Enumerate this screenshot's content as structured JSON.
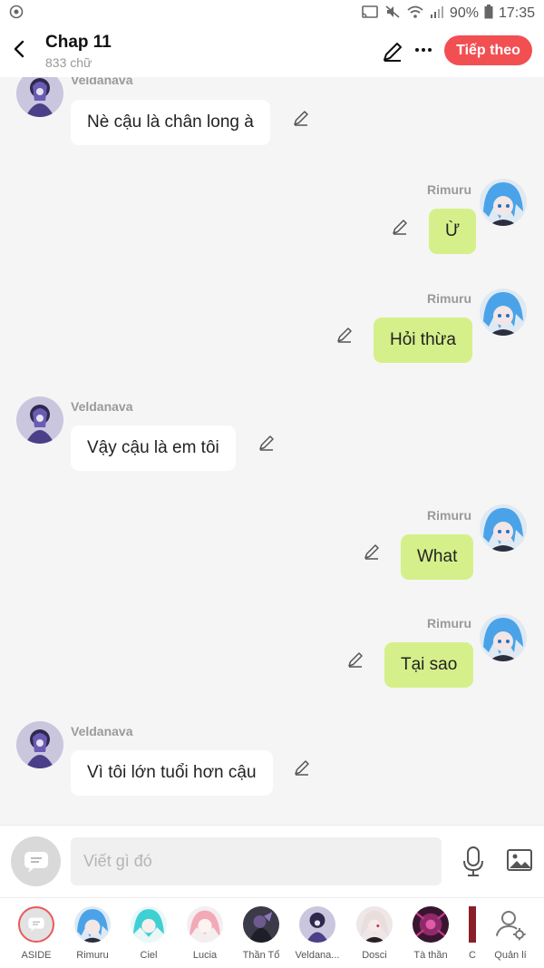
{
  "status_bar": {
    "battery": "90%",
    "time": "17:35"
  },
  "header": {
    "title": "Chap 11",
    "word_count": "833 chữ",
    "next_label": "Tiếp theo"
  },
  "messages": [
    {
      "sender": "Veldanava",
      "text": "Nè cậu là chân long à",
      "side": "left",
      "avatar": "veldanava-avatar"
    },
    {
      "sender": "Rimuru",
      "text": "Ừ",
      "side": "right",
      "avatar": "rimuru-avatar"
    },
    {
      "sender": "Rimuru",
      "text": "Hỏi thừa",
      "side": "right",
      "avatar": "rimuru-avatar"
    },
    {
      "sender": "Veldanava",
      "text": "Vậy cậu là em tôi",
      "side": "left",
      "avatar": "veldanava-avatar"
    },
    {
      "sender": "Rimuru",
      "text": "What",
      "side": "right",
      "avatar": "rimuru-avatar"
    },
    {
      "sender": "Rimuru",
      "text": "Tại sao",
      "side": "right",
      "avatar": "rimuru-avatar"
    },
    {
      "sender": "Veldanava",
      "text": "Vì tôi lớn tuổi hơn cậu",
      "side": "left",
      "avatar": "veldanava-avatar"
    }
  ],
  "composer": {
    "placeholder": "Viết gì đó",
    "value": ""
  },
  "characters": [
    {
      "name": "ASIDE"
    },
    {
      "name": "Rimuru"
    },
    {
      "name": "Ciel"
    },
    {
      "name": "Lucia"
    },
    {
      "name": "Thần Tổ"
    },
    {
      "name": "Veldana..."
    },
    {
      "name": "Dosci"
    },
    {
      "name": "Tà thần"
    },
    {
      "name": "C"
    },
    {
      "name": "Quản lí"
    }
  ],
  "colors": {
    "accent": "#f24f53",
    "right_bubble": "#d5f08a",
    "left_bubble": "#ffffff",
    "background": "#f5f5f5"
  }
}
